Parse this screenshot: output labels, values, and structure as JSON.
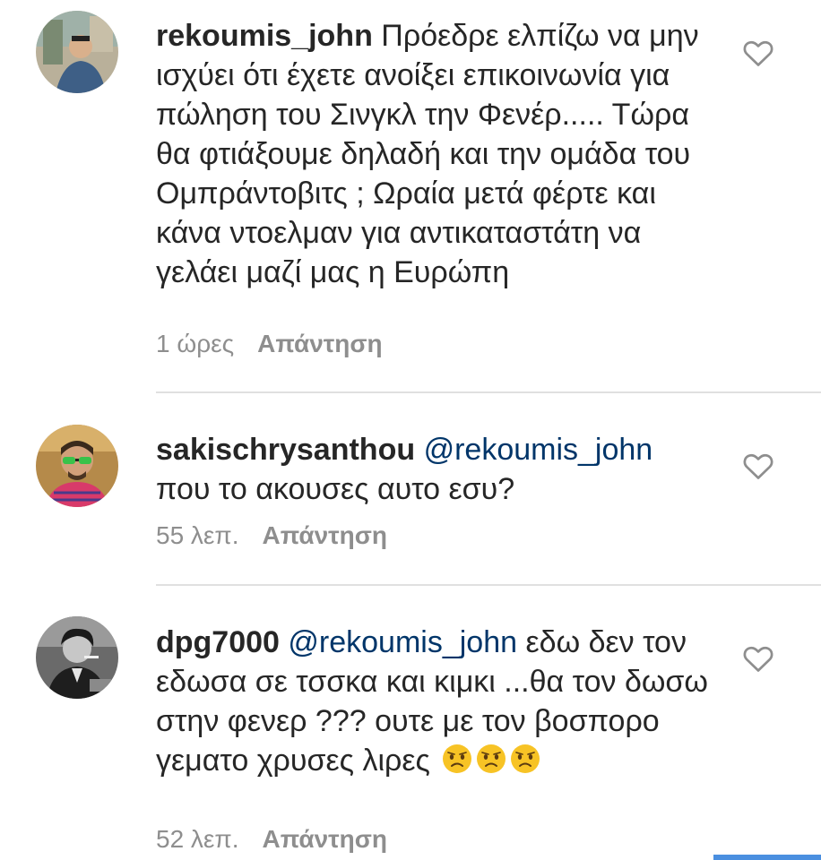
{
  "comments": [
    {
      "username": "rekoumis_john",
      "mention": "",
      "text": "Πρόεδρε ελπίζω να μην ισχύει ότι έχετε ανοίξει επικοινωνία για πώληση του Σινγκλ την Φενέρ..... Τώρα θα φτιάξουμε δηλαδή και την ομάδα του Ομπράντοβιτς ; Ωραία μετά φέρτε και κάνα ντοελμαν για αντικαταστάτη να γελάει μαζί μας η Ευρώπη",
      "time": "1 ώρες",
      "reply": "Απάντηση"
    },
    {
      "username": "sakischrysanthou",
      "mention": "@rekoumis_john",
      "text": "που το ακουσες αυτο εσυ?",
      "time": "55 λεπ.",
      "reply": "Απάντηση"
    },
    {
      "username": "dpg7000",
      "mention": "@rekoumis_john",
      "text": "εδω δεν τον εδωσα σε τσσκα και κιμκι ...θα τον δωσω στην φενερ ??? ουτε με τον βοσπορο γεματο χρυσες λιρες",
      "time": "52 λεπ.",
      "reply": "Απάντηση"
    }
  ],
  "icons": {
    "like": "heart-outline-icon",
    "emoji": "confused-face-emoji"
  },
  "colors": {
    "mention": "#003569",
    "meta": "#8e8e8e",
    "divider": "#e0e0e0"
  }
}
